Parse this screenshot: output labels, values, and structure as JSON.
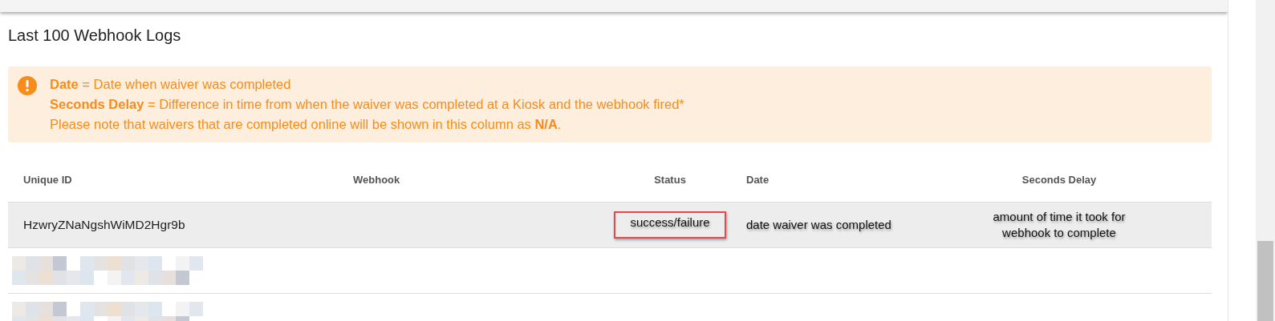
{
  "title": "Last 100 Webhook Logs",
  "alert": {
    "lines": [
      "**Date** = Date when waiver was completed",
      "**Seconds Delay** = Difference in time from when the waiver was completed at a Kiosk and the webhook fired*",
      "Please note that waivers that are completed online will be shown in this column as **N/A**."
    ]
  },
  "table": {
    "columns": [
      "Unique ID",
      "Webhook",
      "Status",
      "Date",
      "Seconds Delay"
    ],
    "rows": [
      {
        "kind": "annotated",
        "selected": true,
        "unique_id": "HzwryZNaNgshWiMD2Hgr9b",
        "status": "success/failure",
        "status_highlighted": true,
        "date": "date waiver was completed",
        "seconds_delay": "amount of time it took for webhook to complete"
      },
      {
        "kind": "redacted",
        "selected": false
      },
      {
        "kind": "redacted",
        "selected": false
      }
    ]
  }
}
